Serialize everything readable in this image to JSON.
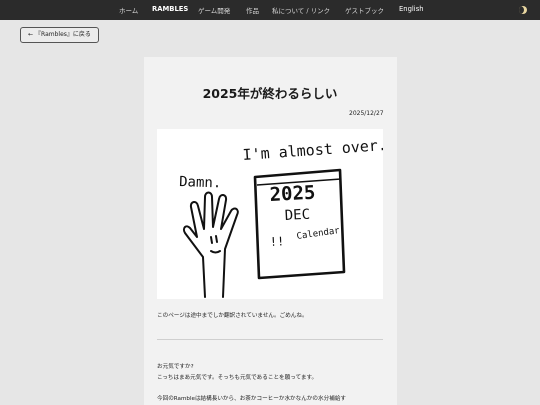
{
  "nav": {
    "home": "ホーム",
    "rambles": "RAMBLES",
    "game_dev": "ゲーム開発",
    "works": "作品",
    "about": "私について / リンク",
    "guestbook": "ゲストブック",
    "language": "English"
  },
  "back_button": "← 『Rambles』に戻る",
  "post": {
    "title": "2025年が終わるらしい",
    "date": "2025/12/27",
    "translation_note": "このページは途中までしか翻訳されていません。ごめんね。",
    "para1_line1": "お元気ですか?",
    "para1_line2": "こっちはまあ元気です。そっちも元気であることを願ってます。",
    "para2_line1": "今回のRambleは結構長いから、お茶かコーヒーか水かなんかの水分補給す"
  },
  "illustration": {
    "text_top": "I'm almost over.",
    "text_left": "Damn.",
    "calendar_year": "2025",
    "calendar_month": "DEC",
    "calendar_word": "Calendar",
    "calendar_mark": "!!"
  },
  "colors": {
    "topbar": "#2b2b2b",
    "page_bg": "#e6e6e6",
    "card_bg": "#f2f2f2"
  }
}
